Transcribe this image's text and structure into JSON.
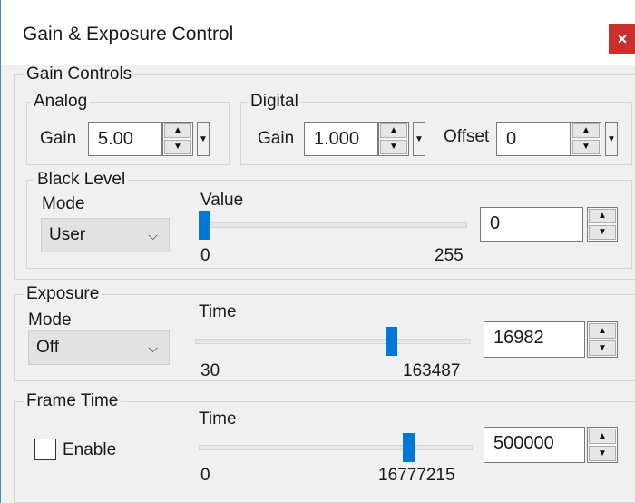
{
  "window": {
    "title": "Gain & Exposure Control",
    "close_label": "×"
  },
  "gain_controls": {
    "label": "Gain Controls",
    "analog": {
      "label": "Analog",
      "gain_label": "Gain",
      "gain_value": "5.00"
    },
    "digital": {
      "label": "Digital",
      "gain_label": "Gain",
      "gain_value": "1.000",
      "offset_label": "Offset",
      "offset_value": "0"
    },
    "black_level": {
      "label": "Black Level",
      "mode_label": "Mode",
      "mode_value": "User",
      "value_label": "Value",
      "slider_min": "0",
      "slider_max": "255",
      "value": "0",
      "slider_fraction": 0.0
    }
  },
  "exposure": {
    "label": "Exposure",
    "mode_label": "Mode",
    "mode_value": "Off",
    "time_label": "Time",
    "slider_min": "30",
    "slider_max": "163487",
    "value": "16982",
    "slider_fraction": 0.72
  },
  "frame_time": {
    "label": "Frame Time",
    "enable_label": "Enable",
    "enabled": false,
    "time_label": "Time",
    "slider_min": "0",
    "slider_max": "16777215",
    "value": "500000",
    "slider_fraction": 0.78
  },
  "icons": {
    "up": "▲",
    "down": "▼",
    "dropdown": "▼",
    "chevron": "⌵"
  },
  "colors": {
    "accent": "#0078d7",
    "close": "#c9302c",
    "window_border": "#4a86c8"
  }
}
